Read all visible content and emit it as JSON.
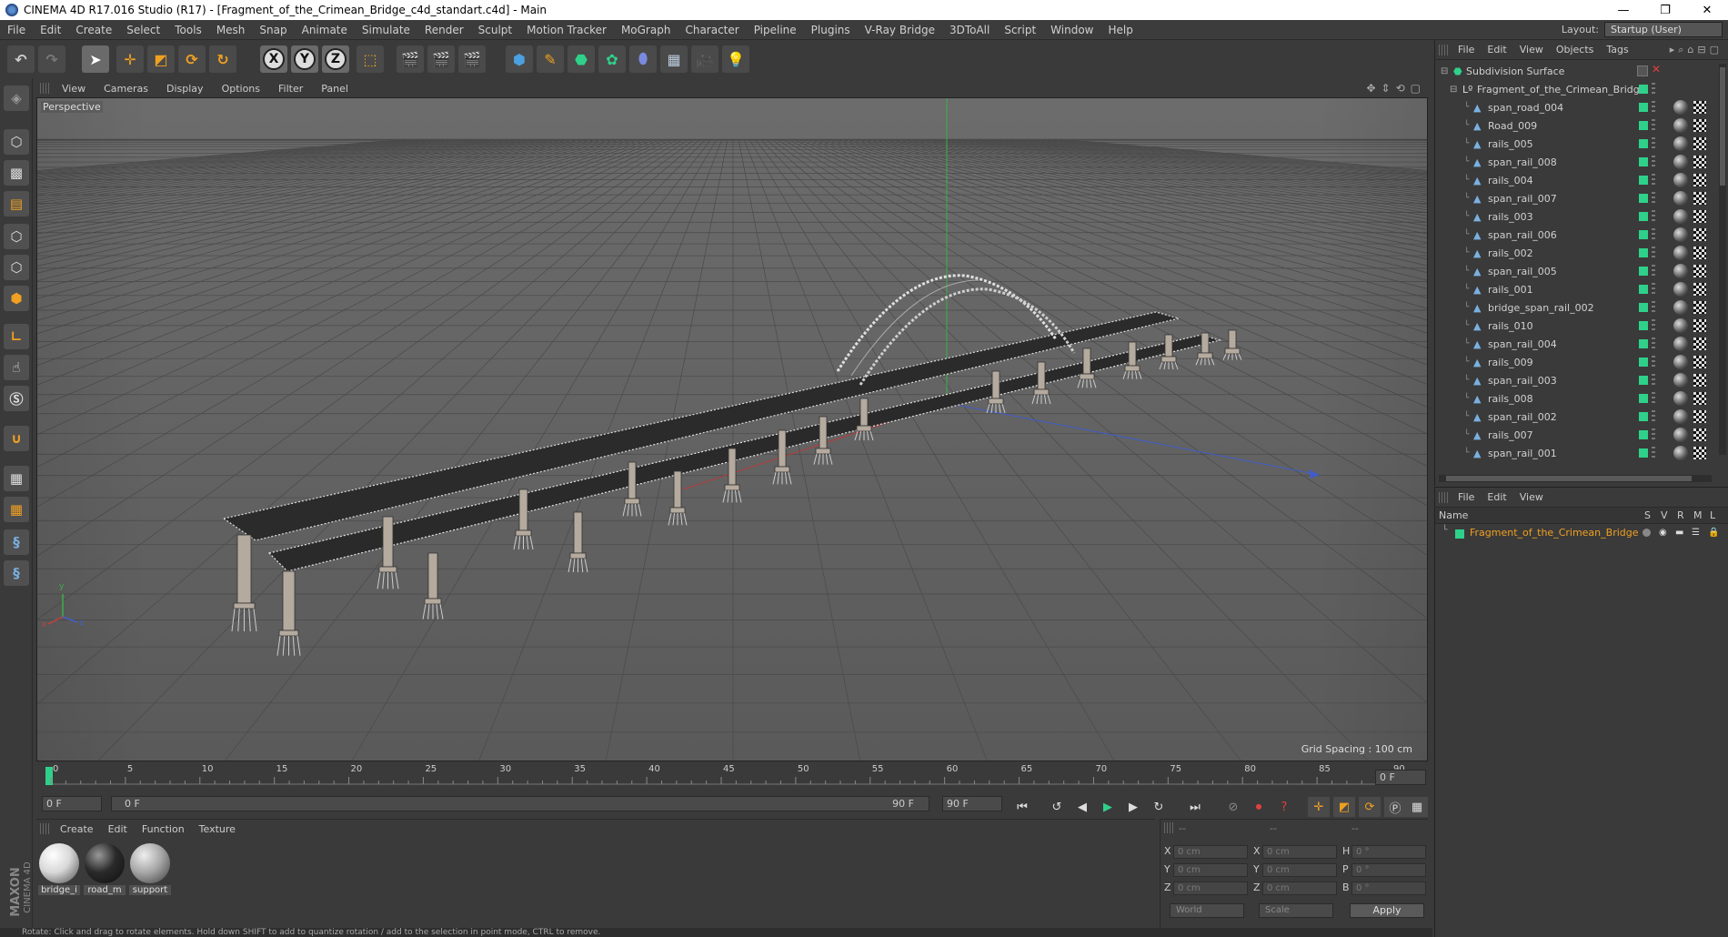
{
  "window": {
    "title": "CINEMA 4D R17.016 Studio (R17) - [Fragment_of_the_Crimean_Bridge_c4d_standart.c4d] - Main",
    "controls": [
      "—",
      "❐",
      "✕"
    ]
  },
  "menubar": {
    "items": [
      "File",
      "Edit",
      "Create",
      "Select",
      "Tools",
      "Mesh",
      "Snap",
      "Animate",
      "Simulate",
      "Render",
      "Sculpt",
      "Motion Tracker",
      "MoGraph",
      "Character",
      "Pipeline",
      "Plugins",
      "V-Ray Bridge",
      "3DToAll",
      "Script",
      "Window",
      "Help"
    ],
    "layout_label": "Layout:",
    "layout_value": "Startup (User)"
  },
  "toolbar": {
    "axis_x": "X",
    "axis_y": "Y",
    "axis_z": "Z"
  },
  "viewport_menu": {
    "items": [
      "View",
      "Cameras",
      "Display",
      "Options",
      "Filter",
      "Panel"
    ]
  },
  "viewport": {
    "label": "Perspective",
    "grid_spacing": "Grid Spacing : 100 cm",
    "axis_x": "x",
    "axis_y": "y",
    "axis_z": "z"
  },
  "timeline": {
    "ticks": [
      "0",
      "5",
      "10",
      "15",
      "20",
      "25",
      "30",
      "35",
      "40",
      "45",
      "50",
      "55",
      "60",
      "65",
      "70",
      "75",
      "80",
      "85",
      "90"
    ],
    "current_frame": "0 F"
  },
  "playback": {
    "start": "0 F",
    "range_start": "0 F",
    "range_end": "90 F",
    "end": "90 F"
  },
  "materials": {
    "menu": [
      "Create",
      "Edit",
      "Function",
      "Texture"
    ],
    "items": [
      {
        "name": "bridge_i",
        "color": "#e8e8e8"
      },
      {
        "name": "road_m",
        "color": "#2a2a2a"
      },
      {
        "name": "support",
        "color": "#a8a8a8"
      }
    ]
  },
  "coordinates": {
    "headers": [
      "--",
      "--",
      "--"
    ],
    "rows": [
      {
        "a1": "X",
        "v1": "0 cm",
        "a2": "X",
        "v2": "0 cm",
        "a3": "H",
        "v3": "0 °"
      },
      {
        "a1": "Y",
        "v1": "0 cm",
        "a2": "Y",
        "v2": "0 cm",
        "a3": "P",
        "v3": "0 °"
      },
      {
        "a1": "Z",
        "v1": "0 cm",
        "a2": "Z",
        "v2": "0 cm",
        "a3": "B",
        "v3": "0 °"
      }
    ],
    "mode_world": "World",
    "mode_scale": "Scale",
    "apply": "Apply"
  },
  "objects_panel": {
    "menu": [
      "File",
      "Edit",
      "View",
      "Objects",
      "Tags"
    ],
    "root": "Subdivision Surface",
    "group": "Fragment_of_the_Crimean_Bridge",
    "children": [
      "span_road_004",
      "Road_009",
      "rails_005",
      "span_rail_008",
      "rails_004",
      "span_rail_007",
      "rails_003",
      "span_rail_006",
      "rails_002",
      "span_rail_005",
      "rails_001",
      "bridge_span_rail_002",
      "rails_010",
      "span_rail_004",
      "rails_009",
      "span_rail_003",
      "rails_008",
      "span_rail_002",
      "rails_007",
      "span_rail_001"
    ]
  },
  "layers_panel": {
    "menu": [
      "File",
      "Edit",
      "View"
    ],
    "headers": {
      "name": "Name",
      "s": "S",
      "v": "V",
      "r": "R",
      "m": "M",
      "l": "L"
    },
    "row": "Fragment_of_the_Crimean_Bridge"
  },
  "status": {
    "text": "Rotate: Click and drag to rotate elements. Hold down SHIFT to add to quantize rotation / add to the selection in point mode, CTRL to remove."
  },
  "brand": {
    "line1": "MAXON",
    "line2": "CINEMA 4D"
  },
  "colors": {
    "accent_green": "#2fd18a",
    "layer_orange": "#f0a020",
    "highlight_blue": "#4aa0e0"
  }
}
